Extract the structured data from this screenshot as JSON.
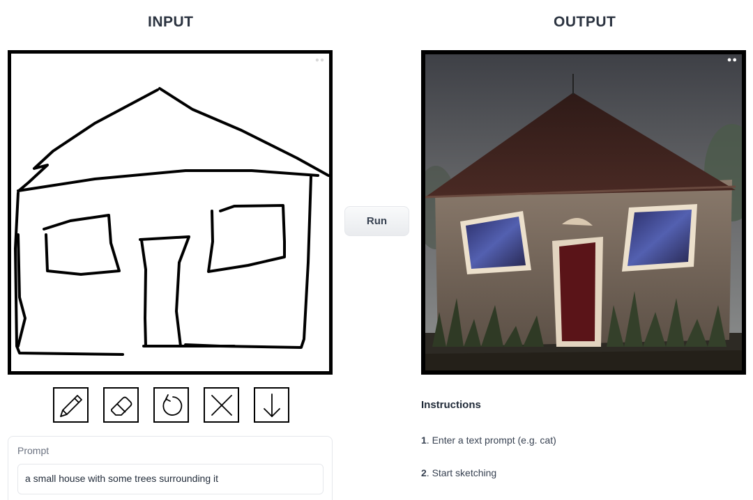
{
  "input_panel": {
    "heading": "INPUT",
    "tools": [
      {
        "name": "pencil-icon",
        "tool": "draw"
      },
      {
        "name": "eraser-icon",
        "tool": "erase"
      },
      {
        "name": "undo-icon",
        "tool": "undo"
      },
      {
        "name": "clear-icon",
        "tool": "clear"
      },
      {
        "name": "download-icon",
        "tool": "download"
      }
    ]
  },
  "run_button": {
    "label": "Run"
  },
  "output_panel": {
    "heading": "OUTPUT"
  },
  "instructions": {
    "title": "Instructions",
    "steps": [
      {
        "number": "1",
        "text": ". Enter a text prompt (e.g. cat)"
      },
      {
        "number": "2",
        "text": ". Start sketching"
      }
    ]
  },
  "prompt": {
    "label": "Prompt",
    "value": "a small house with some trees surrounding it"
  }
}
